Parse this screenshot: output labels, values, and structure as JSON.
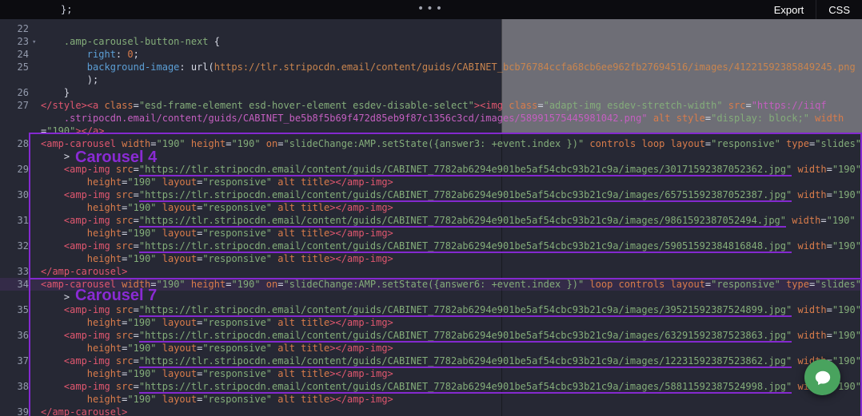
{
  "topbar": {
    "clipped_fragment": "};",
    "drag_dots": "•••",
    "export_label": "Export",
    "css_label": "CSS"
  },
  "annotations": {
    "color": "#8429cf",
    "labels": [
      {
        "text": "Carousel 4"
      },
      {
        "text": "Carousel 7"
      }
    ]
  },
  "colors": {
    "annotation": "#8429cf",
    "chat_button": "#49a35e",
    "editor_background": "#262834",
    "topbar_background": "#0c0c10"
  },
  "editor": {
    "rows": [
      {
        "ln": "22",
        "seg": []
      },
      {
        "ln": "23",
        "fold": true,
        "seg": [
          [
            "fg",
            "    "
          ],
          [
            "sel",
            ".amp-carousel-button-next"
          ],
          [
            "fg",
            " {"
          ]
        ]
      },
      {
        "ln": "24",
        "seg": [
          [
            "fg",
            "        "
          ],
          [
            "prop",
            "right"
          ],
          [
            "fg",
            ": "
          ],
          [
            "num",
            "0"
          ],
          [
            "fg",
            ";"
          ]
        ]
      },
      {
        "ln": "25",
        "seg": [
          [
            "fg",
            "        "
          ],
          [
            "prop",
            "background-image"
          ],
          [
            "fg",
            ": "
          ],
          [
            "fg",
            "url("
          ],
          [
            "curl",
            "https://tlr.stripocdn.email/content/guids/CABINET_bcb76784ccfa68cb6ee962fb27694516/images/41221592385849245.png"
          ]
        ]
      },
      {
        "ln": "",
        "seg": [
          [
            "fg",
            "        );"
          ]
        ]
      },
      {
        "ln": "26",
        "seg": [
          [
            "fg",
            "    }"
          ]
        ]
      },
      {
        "ln": "27",
        "seg": [
          [
            "tag",
            "</style>"
          ],
          [
            "tag",
            "<a"
          ],
          [
            "attr",
            " class"
          ],
          [
            "fg",
            "="
          ],
          [
            "str",
            "\"esd-frame-element esd-hover-element esdev-disable-select\""
          ],
          [
            "tag",
            "><img"
          ],
          [
            "attr",
            " class"
          ],
          [
            "fg",
            "="
          ],
          [
            "str",
            "\"adapt-img esdev-stretch-width\""
          ],
          [
            "attr",
            " src"
          ],
          [
            "fg",
            "="
          ],
          [
            "strp",
            "\"https://iiqf"
          ]
        ]
      },
      {
        "ln": "",
        "seg": [
          [
            "strp",
            "    .stripocdn.email/content/guids/CABINET_be5b8f5b69f472d85eb9f87c1356c3cd/images/58991575445981042.png\""
          ],
          [
            "attr",
            " alt"
          ],
          [
            "attr",
            " style"
          ],
          [
            "fg",
            "="
          ],
          [
            "str",
            "\"display: block;\""
          ],
          [
            "attr",
            " width"
          ]
        ]
      },
      {
        "ln": "",
        "seg": [
          [
            "fg",
            "="
          ],
          [
            "str",
            "\"190\""
          ],
          [
            "tag",
            "></a>"
          ]
        ]
      },
      {
        "ln": "28",
        "seg": [
          [
            "tag",
            "<amp-carousel"
          ],
          [
            "attr",
            " width"
          ],
          [
            "fg",
            "="
          ],
          [
            "str",
            "\"190\""
          ],
          [
            "attr",
            " height"
          ],
          [
            "fg",
            "="
          ],
          [
            "str",
            "\"190\""
          ],
          [
            "attr",
            " on"
          ],
          [
            "fg",
            "="
          ],
          [
            "str",
            "\"slideChange:AMP.setState({answer3: +event.index })\""
          ],
          [
            "attr",
            " controls"
          ],
          [
            "attr",
            " loop"
          ],
          [
            "attr",
            " layout"
          ],
          [
            "fg",
            "="
          ],
          [
            "str",
            "\"responsive\""
          ],
          [
            "attr",
            " type"
          ],
          [
            "fg",
            "="
          ],
          [
            "str",
            "\"slides\""
          ]
        ]
      },
      {
        "ln": "",
        "seg": [
          [
            "fg",
            "    >"
          ]
        ]
      },
      {
        "ln": "29",
        "seg": [
          [
            "fg",
            "    "
          ],
          [
            "tag",
            "<amp-img"
          ],
          [
            "attr",
            " src"
          ],
          [
            "fg",
            "="
          ],
          [
            "url",
            "\"https://tlr.stripocdn.email/content/guids/CABINET_7782ab6294e901be5af54cbc93b21c9a/images/30171592387052362.jpg\""
          ],
          [
            "attr",
            " width"
          ],
          [
            "fg",
            "="
          ],
          [
            "str",
            "\"190\""
          ]
        ]
      },
      {
        "ln": "",
        "seg": [
          [
            "fg",
            "        "
          ],
          [
            "attr",
            "height"
          ],
          [
            "fg",
            "="
          ],
          [
            "str",
            "\"190\""
          ],
          [
            "attr",
            " layout"
          ],
          [
            "fg",
            "="
          ],
          [
            "str",
            "\"responsive\""
          ],
          [
            "attr",
            " alt"
          ],
          [
            "attr",
            " title"
          ],
          [
            "tag",
            "></amp-img>"
          ]
        ]
      },
      {
        "ln": "30",
        "seg": [
          [
            "fg",
            "    "
          ],
          [
            "tag",
            "<amp-img"
          ],
          [
            "attr",
            " src"
          ],
          [
            "fg",
            "="
          ],
          [
            "url",
            "\"https://tlr.stripocdn.email/content/guids/CABINET_7782ab6294e901be5af54cbc93b21c9a/images/65751592387052387.jpg\""
          ],
          [
            "attr",
            " width"
          ],
          [
            "fg",
            "="
          ],
          [
            "str",
            "\"190\""
          ]
        ]
      },
      {
        "ln": "",
        "seg": [
          [
            "fg",
            "        "
          ],
          [
            "attr",
            "height"
          ],
          [
            "fg",
            "="
          ],
          [
            "str",
            "\"190\""
          ],
          [
            "attr",
            " layout"
          ],
          [
            "fg",
            "="
          ],
          [
            "str",
            "\"responsive\""
          ],
          [
            "attr",
            " alt"
          ],
          [
            "attr",
            " title"
          ],
          [
            "tag",
            "></amp-img>"
          ]
        ]
      },
      {
        "ln": "31",
        "seg": [
          [
            "fg",
            "    "
          ],
          [
            "tag",
            "<amp-img"
          ],
          [
            "attr",
            " src"
          ],
          [
            "fg",
            "="
          ],
          [
            "url",
            "\"https://tlr.stripocdn.email/content/guids/CABINET_7782ab6294e901be5af54cbc93b21c9a/images/9861592387052494.jpg\""
          ],
          [
            "attr",
            " width"
          ],
          [
            "fg",
            "="
          ],
          [
            "str",
            "\"190\""
          ]
        ]
      },
      {
        "ln": "",
        "seg": [
          [
            "fg",
            "        "
          ],
          [
            "attr",
            "height"
          ],
          [
            "fg",
            "="
          ],
          [
            "str",
            "\"190\""
          ],
          [
            "attr",
            " layout"
          ],
          [
            "fg",
            "="
          ],
          [
            "str",
            "\"responsive\""
          ],
          [
            "attr",
            " alt"
          ],
          [
            "attr",
            " title"
          ],
          [
            "tag",
            "></amp-img>"
          ]
        ]
      },
      {
        "ln": "32",
        "seg": [
          [
            "fg",
            "    "
          ],
          [
            "tag",
            "<amp-img"
          ],
          [
            "attr",
            " src"
          ],
          [
            "fg",
            "="
          ],
          [
            "url",
            "\"https://tlr.stripocdn.email/content/guids/CABINET_7782ab6294e901be5af54cbc93b21c9a/images/59051592384816848.jpg\""
          ],
          [
            "attr",
            " width"
          ],
          [
            "fg",
            "="
          ],
          [
            "str",
            "\"190\""
          ]
        ]
      },
      {
        "ln": "",
        "seg": [
          [
            "fg",
            "        "
          ],
          [
            "attr",
            "height"
          ],
          [
            "fg",
            "="
          ],
          [
            "str",
            "\"190\""
          ],
          [
            "attr",
            " layout"
          ],
          [
            "fg",
            "="
          ],
          [
            "str",
            "\"responsive\""
          ],
          [
            "attr",
            " alt"
          ],
          [
            "attr",
            " title"
          ],
          [
            "tag",
            "></amp-img>"
          ]
        ]
      },
      {
        "ln": "33",
        "seg": [
          [
            "tag",
            "</amp-carousel>"
          ]
        ]
      },
      {
        "ln": "34",
        "hl": true,
        "seg": [
          [
            "tag",
            "<amp-carousel"
          ],
          [
            "attr",
            " width"
          ],
          [
            "fg",
            "="
          ],
          [
            "str",
            "\"190\""
          ],
          [
            "attr",
            " height"
          ],
          [
            "fg",
            "="
          ],
          [
            "str",
            "\"190\""
          ],
          [
            "attr",
            " on"
          ],
          [
            "fg",
            "="
          ],
          [
            "str",
            "\"slideChange:AMP.setState({answer6: +event.index })\""
          ],
          [
            "attr",
            " loop"
          ],
          [
            "attr",
            " controls"
          ],
          [
            "attr",
            " layout"
          ],
          [
            "fg",
            "="
          ],
          [
            "str",
            "\"responsive\""
          ],
          [
            "attr",
            " type"
          ],
          [
            "fg",
            "="
          ],
          [
            "str",
            "\"slides\""
          ]
        ]
      },
      {
        "ln": "",
        "seg": [
          [
            "fg",
            "    >"
          ]
        ]
      },
      {
        "ln": "35",
        "seg": [
          [
            "fg",
            "    "
          ],
          [
            "tag",
            "<amp-img"
          ],
          [
            "attr",
            " src"
          ],
          [
            "fg",
            "="
          ],
          [
            "url",
            "\"https://tlr.stripocdn.email/content/guids/CABINET_7782ab6294e901be5af54cbc93b21c9a/images/39521592387524899.jpg\""
          ],
          [
            "attr",
            " width"
          ],
          [
            "fg",
            "="
          ],
          [
            "str",
            "\"190\""
          ]
        ]
      },
      {
        "ln": "",
        "seg": [
          [
            "fg",
            "        "
          ],
          [
            "attr",
            "height"
          ],
          [
            "fg",
            "="
          ],
          [
            "str",
            "\"190\""
          ],
          [
            "attr",
            " layout"
          ],
          [
            "fg",
            "="
          ],
          [
            "str",
            "\"responsive\""
          ],
          [
            "attr",
            " alt"
          ],
          [
            "attr",
            " title"
          ],
          [
            "tag",
            "></amp-img>"
          ]
        ]
      },
      {
        "ln": "36",
        "seg": [
          [
            "fg",
            "    "
          ],
          [
            "tag",
            "<amp-img"
          ],
          [
            "attr",
            " src"
          ],
          [
            "fg",
            "="
          ],
          [
            "url",
            "\"https://tlr.stripocdn.email/content/guids/CABINET_7782ab6294e901be5af54cbc93b21c9a/images/63291592387523863.jpg\""
          ],
          [
            "attr",
            " width"
          ],
          [
            "fg",
            "="
          ],
          [
            "str",
            "\"190\""
          ]
        ]
      },
      {
        "ln": "",
        "seg": [
          [
            "fg",
            "        "
          ],
          [
            "attr",
            "height"
          ],
          [
            "fg",
            "="
          ],
          [
            "str",
            "\"190\""
          ],
          [
            "attr",
            " layout"
          ],
          [
            "fg",
            "="
          ],
          [
            "str",
            "\"responsive\""
          ],
          [
            "attr",
            " alt"
          ],
          [
            "attr",
            " title"
          ],
          [
            "tag",
            "></amp-img>"
          ]
        ]
      },
      {
        "ln": "37",
        "seg": [
          [
            "fg",
            "    "
          ],
          [
            "tag",
            "<amp-img"
          ],
          [
            "attr",
            " src"
          ],
          [
            "fg",
            "="
          ],
          [
            "url",
            "\"https://tlr.stripocdn.email/content/guids/CABINET_7782ab6294e901be5af54cbc93b21c9a/images/12231592387523862.jpg\""
          ],
          [
            "attr",
            " width"
          ],
          [
            "fg",
            "="
          ],
          [
            "str",
            "\"190\""
          ]
        ]
      },
      {
        "ln": "",
        "seg": [
          [
            "fg",
            "        "
          ],
          [
            "attr",
            "height"
          ],
          [
            "fg",
            "="
          ],
          [
            "str",
            "\"190\""
          ],
          [
            "attr",
            " layout"
          ],
          [
            "fg",
            "="
          ],
          [
            "str",
            "\"responsive\""
          ],
          [
            "attr",
            " alt"
          ],
          [
            "attr",
            " title"
          ],
          [
            "tag",
            "></amp-img>"
          ]
        ]
      },
      {
        "ln": "38",
        "seg": [
          [
            "fg",
            "    "
          ],
          [
            "tag",
            "<amp-img"
          ],
          [
            "attr",
            " src"
          ],
          [
            "fg",
            "="
          ],
          [
            "url",
            "\"https://tlr.stripocdn.email/content/guids/CABINET_7782ab6294e901be5af54cbc93b21c9a/images/58811592387524998.jpg\""
          ],
          [
            "attr",
            " width"
          ],
          [
            "fg",
            "="
          ],
          [
            "str",
            "\"190\""
          ]
        ]
      },
      {
        "ln": "",
        "seg": [
          [
            "fg",
            "        "
          ],
          [
            "attr",
            "height"
          ],
          [
            "fg",
            "="
          ],
          [
            "str",
            "\"190\""
          ],
          [
            "attr",
            " layout"
          ],
          [
            "fg",
            "="
          ],
          [
            "str",
            "\"responsive\""
          ],
          [
            "attr",
            " alt"
          ],
          [
            "attr",
            " title"
          ],
          [
            "tag",
            "></amp-img>"
          ]
        ]
      },
      {
        "ln": "39",
        "seg": [
          [
            "tag",
            "</amp-carousel>"
          ]
        ]
      }
    ]
  }
}
